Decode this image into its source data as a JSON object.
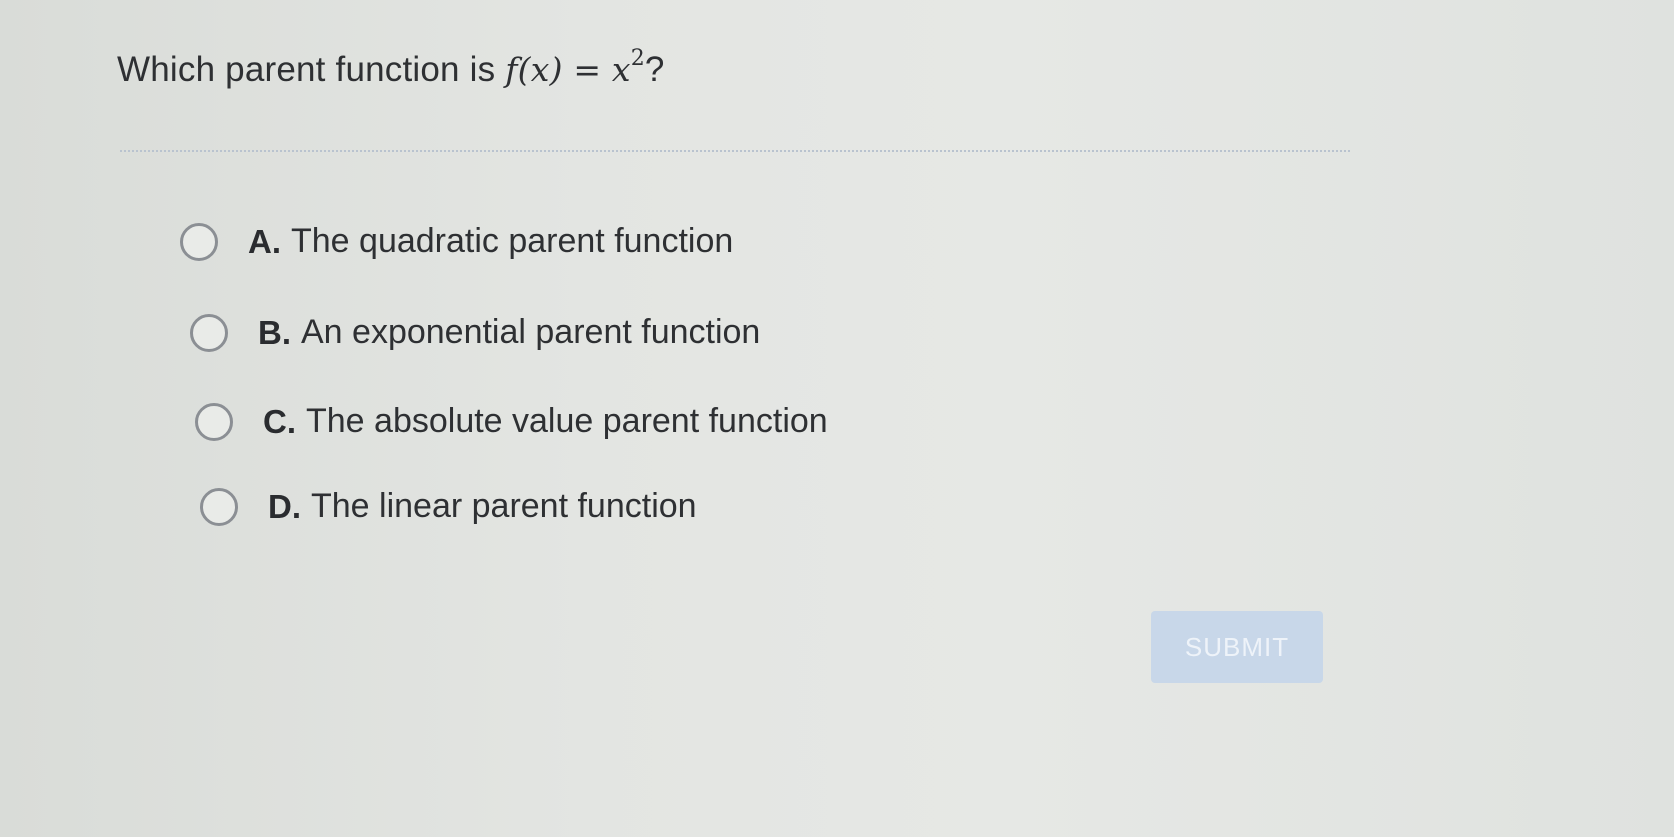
{
  "question": {
    "prefix": "Which parent function is ",
    "function_name": "f",
    "open_paren": "(",
    "variable": "x",
    "close_paren": ")",
    "equals": " = ",
    "base": "x",
    "exponent": "2",
    "suffix": "?"
  },
  "options": [
    {
      "letter": "A.",
      "text": "The quadratic parent function"
    },
    {
      "letter": "B.",
      "text": "An exponential parent function"
    },
    {
      "letter": "C.",
      "text": "The absolute value parent function"
    },
    {
      "letter": "D.",
      "text": "The linear parent function"
    }
  ],
  "submit_label": "SUBMIT",
  "colors": {
    "submit_background": "#c8d7e9",
    "radio_border": "#8b8f94",
    "divider": "#b9c3cf"
  }
}
